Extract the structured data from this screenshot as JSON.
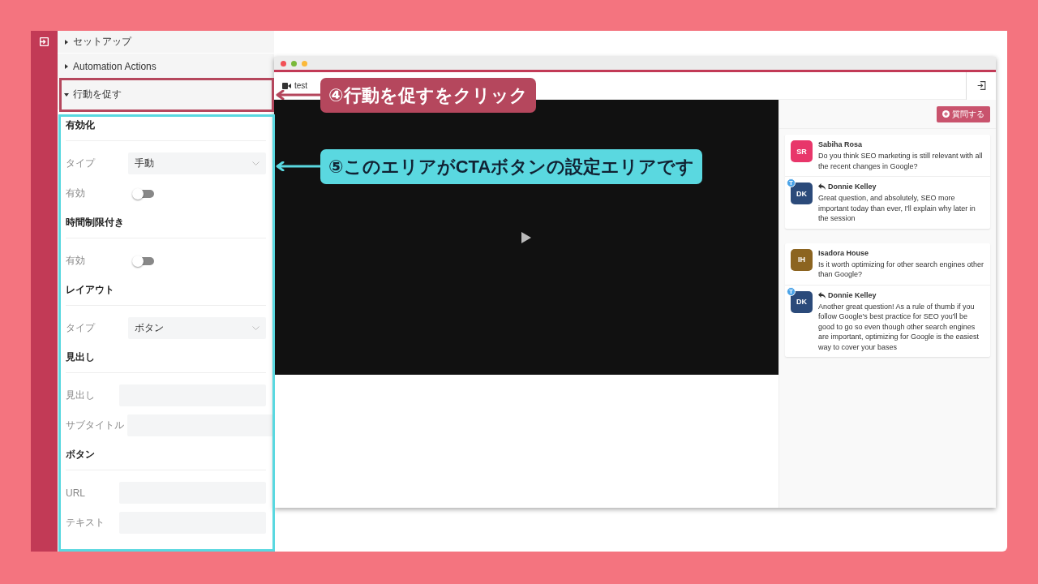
{
  "sidebar": {
    "sections": [
      {
        "label": "セットアップ",
        "expanded": false
      },
      {
        "label": "Automation Actions",
        "expanded": false
      },
      {
        "label": "行動を促す",
        "expanded": true
      }
    ],
    "settings": [
      {
        "heading": "有効化",
        "rows": [
          {
            "kind": "select",
            "label": "タイプ",
            "value": "手動"
          },
          {
            "kind": "toggle",
            "label": "有効",
            "on": false
          }
        ]
      },
      {
        "heading": "時間制限付き",
        "rows": [
          {
            "kind": "toggle",
            "label": "有効",
            "on": false
          }
        ]
      },
      {
        "heading": "レイアウト",
        "rows": [
          {
            "kind": "select",
            "label": "タイプ",
            "value": "ボタン"
          }
        ]
      },
      {
        "heading": "見出し",
        "rows": [
          {
            "kind": "input",
            "label": "見出し"
          },
          {
            "kind": "input",
            "label": "サブタイトル"
          }
        ]
      },
      {
        "heading": "ボタン",
        "rows": [
          {
            "kind": "input",
            "label": "URL"
          },
          {
            "kind": "input",
            "label": "テキスト"
          }
        ]
      }
    ]
  },
  "browser": {
    "tab": "test",
    "ask_button": "質問する",
    "questions": [
      {
        "initials": "SR",
        "color": "#e8366a",
        "name": "Sabiha Rosa",
        "text": "Do you think SEO marketing is still relevant with all the recent changes in Google?",
        "reply": {
          "initials": "DK",
          "color": "#2b4a7a",
          "badge": "T",
          "name": "Donnie Kelley",
          "text": "Great question, and absolutely, SEO more important today than ever, I'll explain why later in the session"
        }
      },
      {
        "initials": "IH",
        "color": "#8c6420",
        "name": "Isadora House",
        "text": "Is it worth optimizing for other search engines other than Google?",
        "reply": {
          "initials": "DK",
          "color": "#2b4a7a",
          "badge": "T",
          "name": "Donnie Kelley",
          "text": "Another great question! As a rule of thumb if you follow Google's best practice for SEO you'll be good to go so even though other search engines are important, optimizing for Google is the easiest way to cover your bases"
        }
      }
    ]
  },
  "callouts": [
    {
      "text": "④行動を促すをクリック",
      "color": "#b5475d"
    },
    {
      "text": "⑤このエリアがCTAボタンの設定エリアです",
      "color": "#5ad8e0"
    }
  ]
}
